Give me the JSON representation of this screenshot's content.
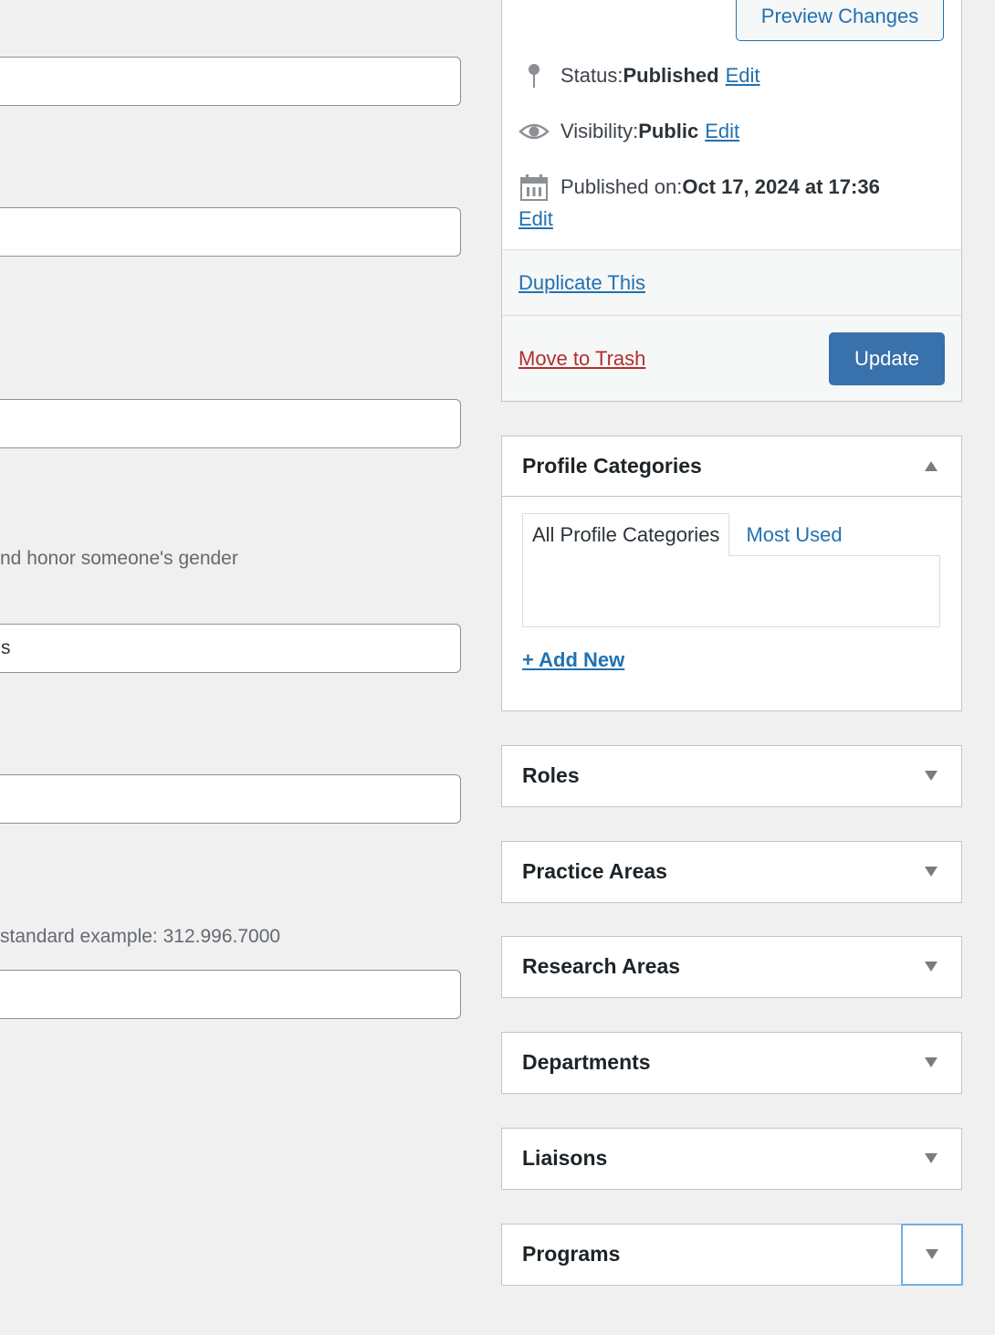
{
  "left_column": {
    "fields": [
      {
        "value": "",
        "placeholder": ""
      },
      {
        "value": "",
        "placeholder": ""
      },
      {
        "value": "",
        "placeholder": ""
      },
      {
        "value": "s",
        "placeholder": ""
      },
      {
        "value": "",
        "placeholder": ""
      },
      {
        "value": "",
        "placeholder": ""
      }
    ],
    "pronouns_description": "nd honor someone's gender",
    "phone_description": "standard example: 312.996.7000"
  },
  "publish": {
    "preview_button": "Preview Changes",
    "status_label": "Status: ",
    "status_value": "Published",
    "visibility_label": "Visibility: ",
    "visibility_value": "Public",
    "published_label": "Published on: ",
    "published_value": "Oct 17, 2024 at 17:36",
    "edit_label": "Edit",
    "duplicate_label": "Duplicate This",
    "trash_label": "Move to Trash",
    "update_button": "Update",
    "icons": [
      "pin-icon",
      "eye-icon",
      "calendar-icon"
    ]
  },
  "profile_categories": {
    "title": "Profile Categories",
    "tabs": [
      "All Profile Categories",
      "Most Used"
    ],
    "add_new": "+ Add New",
    "expanded": true
  },
  "closed_boxes": [
    {
      "title": "Roles"
    },
    {
      "title": "Practice Areas"
    },
    {
      "title": "Research Areas"
    },
    {
      "title": "Departments"
    },
    {
      "title": "Liaisons"
    },
    {
      "title": "Programs"
    }
  ],
  "colors": {
    "link": "#2271b1",
    "primary_button": "#3871ab",
    "trash": "#b32d2e",
    "background": "#f0f0f1",
    "focus": "#72aee6"
  }
}
